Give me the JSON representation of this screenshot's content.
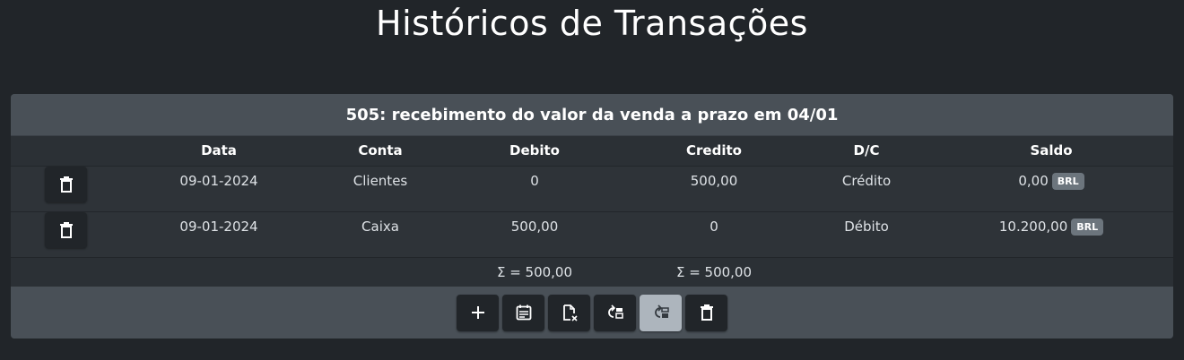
{
  "page": {
    "title": "Históricos de Transações"
  },
  "transaction": {
    "header": "505: recebimento do valor da venda a prazo em 04/01"
  },
  "table": {
    "columns": [
      "",
      "Data",
      "Conta",
      "Debito",
      "Credito",
      "D/C",
      "Saldo"
    ],
    "rows": [
      {
        "data": "09-01-2024",
        "conta": "Clientes",
        "debito": "0",
        "credito": "500,00",
        "dc": "Crédito",
        "saldo": "0,00",
        "currency": "BRL"
      },
      {
        "data": "09-01-2024",
        "conta": "Caixa",
        "debito": "500,00",
        "credito": "0",
        "dc": "Débito",
        "saldo": "10.200,00",
        "currency": "BRL"
      }
    ],
    "totals": {
      "debito": "Σ = 500,00",
      "credito": "Σ = 500,00"
    }
  },
  "toolbar": {
    "buttons": [
      {
        "icon": "plus-icon"
      },
      {
        "icon": "calendar-icon"
      },
      {
        "icon": "file-x-icon"
      },
      {
        "icon": "arrow-left-layout-icon"
      },
      {
        "icon": "arrow-right-layout-icon",
        "active": true
      },
      {
        "icon": "trash-icon"
      }
    ]
  },
  "colors": {
    "background": "#212529",
    "card": "#343a40",
    "header": "#495057",
    "badge": "#6c757d",
    "active_button": "#adb5bd"
  }
}
